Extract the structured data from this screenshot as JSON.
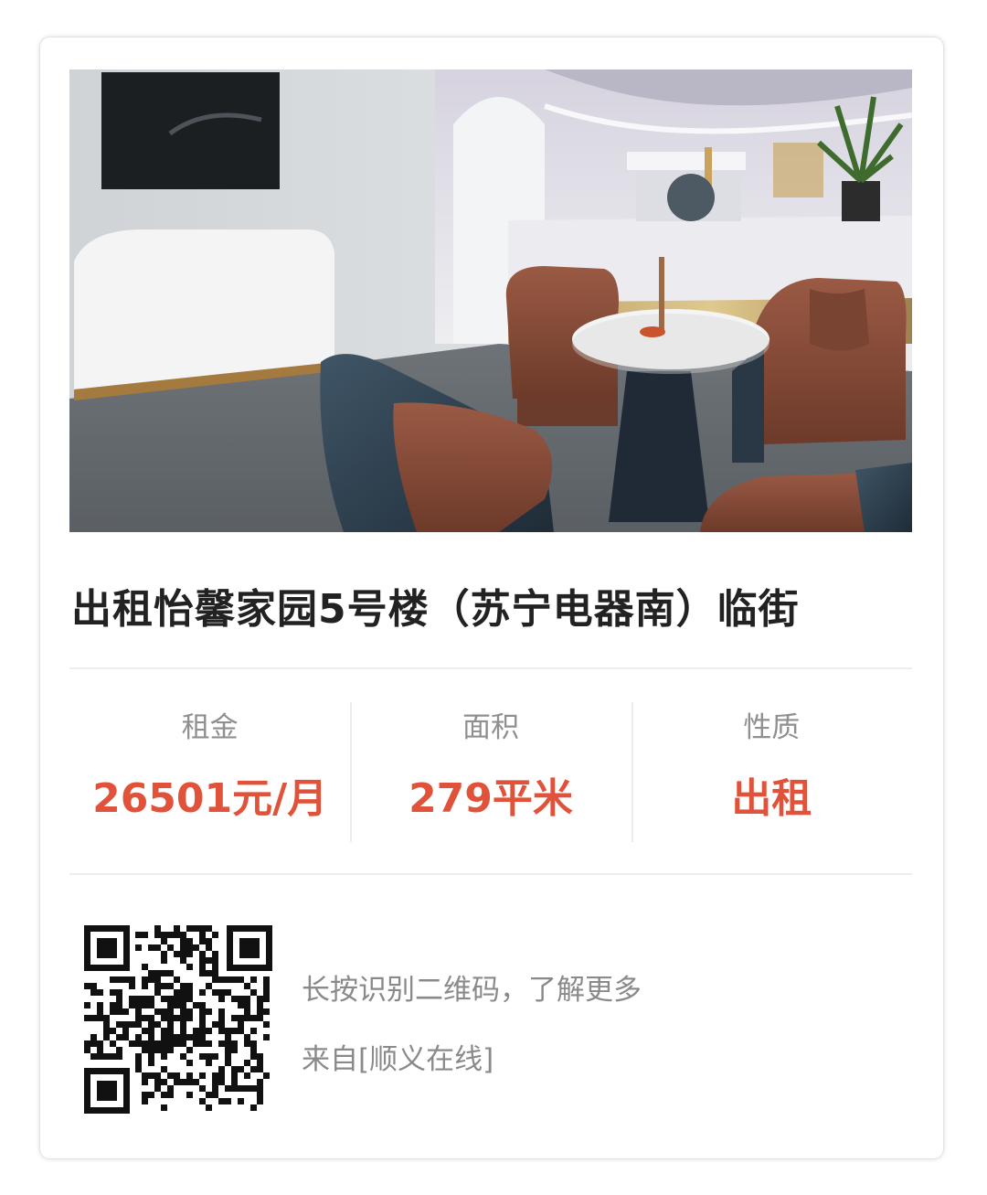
{
  "listing": {
    "title": "出租怡馨家园5号楼（苏宁电器南）临街",
    "photo": "office-lobby-photo",
    "stats": [
      {
        "label": "租金",
        "value": "26501元/月"
      },
      {
        "label": "面积",
        "value": "279平米"
      },
      {
        "label": "性质",
        "value": "出租"
      }
    ]
  },
  "footer": {
    "qr_icon": "qr-code-icon",
    "hint": "长按识别二维码，了解更多",
    "source": "来自[顺义在线]"
  },
  "colors": {
    "accent": "#e0533a",
    "title": "#222222",
    "muted": "#8a8a8a"
  }
}
